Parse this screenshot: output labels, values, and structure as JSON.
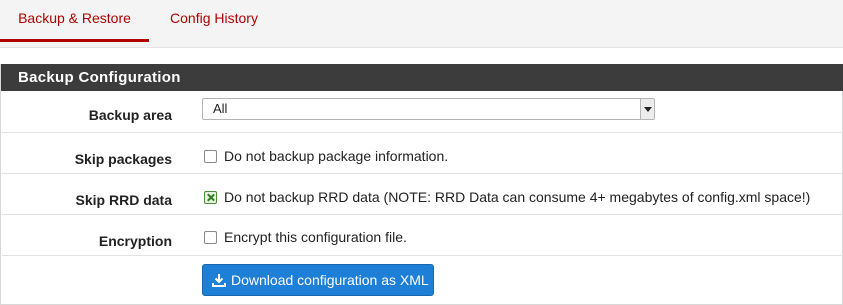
{
  "tabs": [
    {
      "label": "Backup & Restore",
      "active": true
    },
    {
      "label": "Config History",
      "active": false
    }
  ],
  "panel": {
    "title": "Backup Configuration"
  },
  "form": {
    "backup_area": {
      "label": "Backup area",
      "selected": "All"
    },
    "skip_packages": {
      "label": "Skip packages",
      "text": "Do not backup package information.",
      "checked": false
    },
    "skip_rrd": {
      "label": "Skip RRD data",
      "text": "Do not backup RRD data (NOTE: RRD Data can consume 4+ megabytes of config.xml space!)",
      "checked": true
    },
    "encryption": {
      "label": "Encryption",
      "text": "Encrypt this configuration file.",
      "checked": false
    },
    "download_button": {
      "label": "Download configuration as XML",
      "icon": "download-icon"
    }
  },
  "colors": {
    "accent": "#b00000",
    "heading_bg": "#3c3c3c",
    "button_bg": "#1e7fd6"
  }
}
